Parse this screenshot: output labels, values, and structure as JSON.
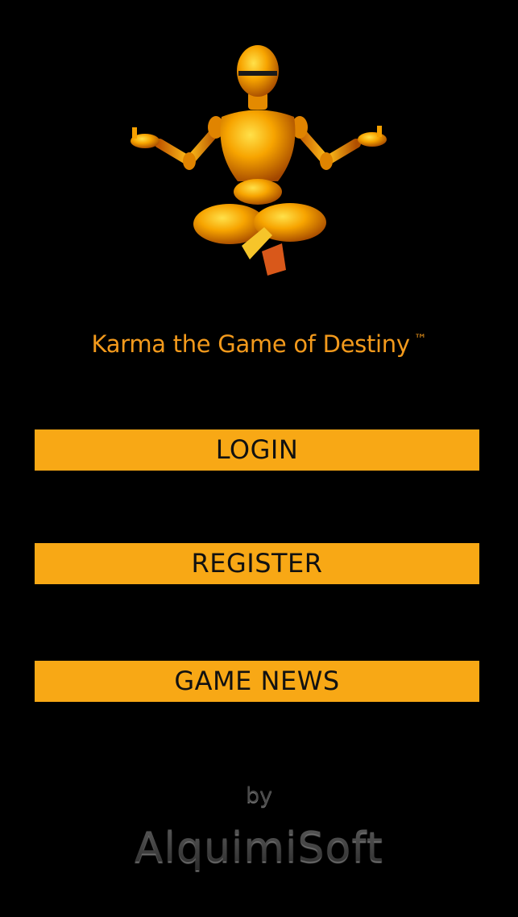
{
  "app": {
    "title": "Karma the Game of Destiny",
    "trademark": "™",
    "mascot": "meditating-robot-icon"
  },
  "menu": {
    "login_label": "LOGIN",
    "register_label": "REGISTER",
    "news_label": "GAME NEWS"
  },
  "footer": {
    "by_label": "by",
    "brand_name": "AlquimiSoft"
  },
  "colors": {
    "background": "#000000",
    "accent": "#f8a815",
    "title_text": "#f39a1c",
    "button_text": "#111111"
  }
}
